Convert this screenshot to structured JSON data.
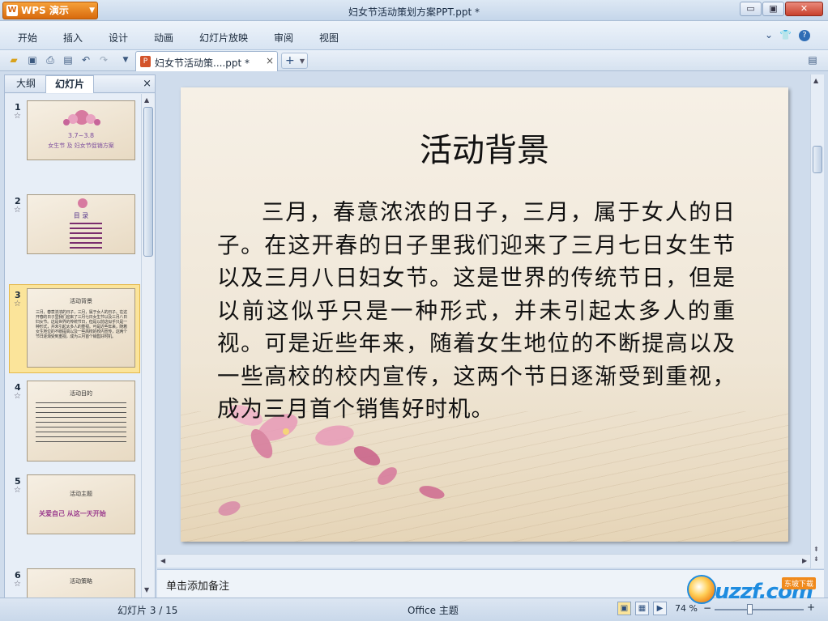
{
  "app": {
    "name": "WPS 演示",
    "window_title": "妇女节活动策划方案PPT.ppt *"
  },
  "window_controls": {
    "minimize": "▭",
    "maximize": "▣",
    "close": "✕"
  },
  "menu": [
    "开始",
    "插入",
    "设计",
    "动画",
    "幻灯片放映",
    "审阅",
    "视图"
  ],
  "menu_right": {
    "help": "?",
    "collapse": "⌄",
    "skin": "👕"
  },
  "doc_tab": {
    "label": "妇女节活动策....ppt *",
    "close": "×"
  },
  "new_tab": "+",
  "panel": {
    "tabs": [
      "大纲",
      "幻灯片"
    ],
    "active": "幻灯片",
    "close": "×"
  },
  "thumbnails": [
    {
      "num": "1",
      "title": "3.7~3.8",
      "subtitle": "女生节 及 妇女节促销方案"
    },
    {
      "num": "2",
      "title": "目  录"
    },
    {
      "num": "3",
      "title": "活动背景",
      "selected": true
    },
    {
      "num": "4",
      "title": "活动目的"
    },
    {
      "num": "5",
      "title": "活动主题",
      "subtitle": "关爱自己 从这一天开始"
    },
    {
      "num": "6",
      "title": "活动策略"
    }
  ],
  "slide": {
    "title": "活动背景",
    "body": "三月，春意浓浓的日子，三月，属于女人的日子。在这开春的日子里我们迎来了三月七日女生节以及三月八日妇女节。这是世界的传统节日，但是以前这似乎只是一种形式，并未引起太多人的重视。可是近些年来，随着女生地位的不断提高以及一些高校的校内宣传，这两个节日逐渐受到重视，成为三月首个销售好时机。"
  },
  "notes_placeholder": "单击添加备注",
  "status": {
    "slide_indicator": "幻灯片 3 / 15",
    "theme": "Office 主题",
    "zoom": "74 %"
  },
  "watermark": {
    "text": "uzzf.com",
    "badge": "东坡下载"
  }
}
